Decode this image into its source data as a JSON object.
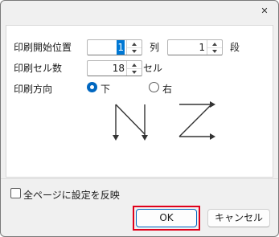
{
  "dialog": {
    "close_glyph": "✕"
  },
  "fields": {
    "print_start_position_label": "印刷開始位置",
    "column_value": "1",
    "column_unit": "列",
    "row_value": "1",
    "row_unit": "段",
    "cell_count_label": "印刷セル数",
    "cell_count_value": "18",
    "cell_count_unit": "セル",
    "direction_label": "印刷方向",
    "direction_options": [
      {
        "label": "下",
        "selected": true
      },
      {
        "label": "右",
        "selected": false
      }
    ]
  },
  "bottom": {
    "apply_all_pages_label": "全ページに設定を反映",
    "apply_all_pages_checked": false,
    "ok_label": "OK",
    "cancel_label": "キャンセル"
  },
  "colors": {
    "accent": "#0067c0",
    "highlight": "#e0001b"
  }
}
